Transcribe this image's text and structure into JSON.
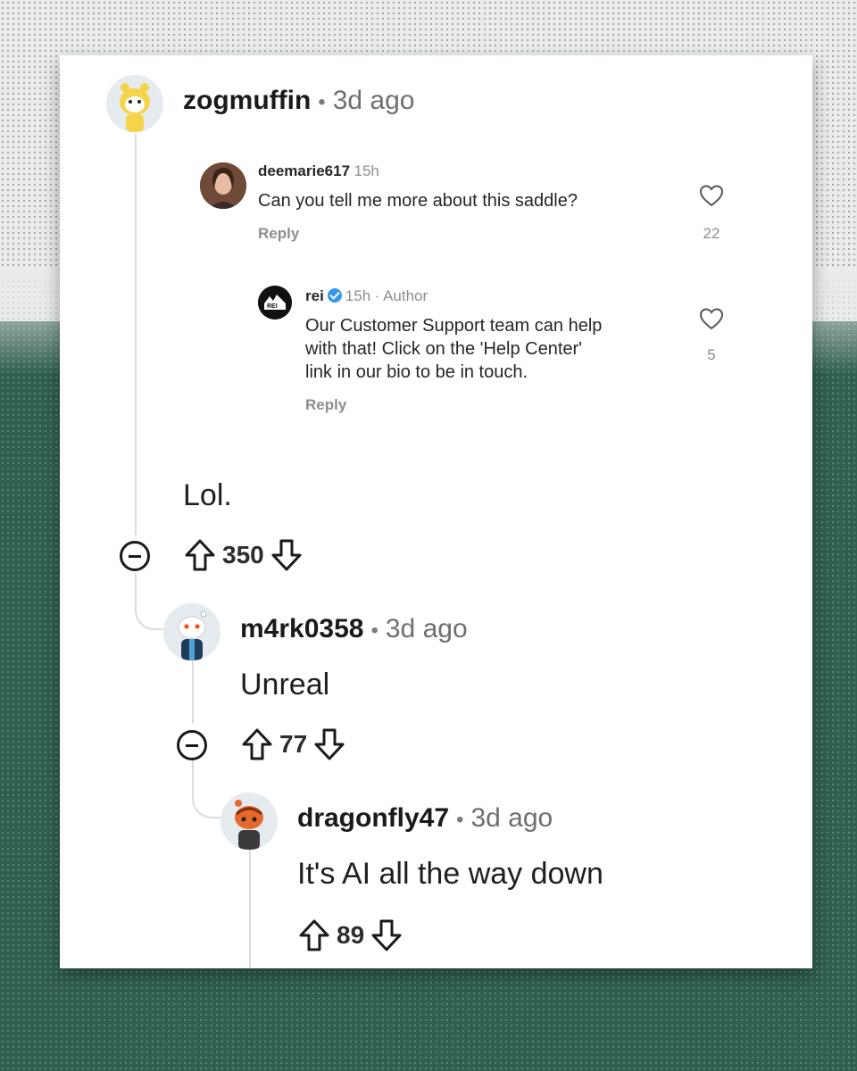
{
  "comments": [
    {
      "id": "c1",
      "username": "zogmuffin",
      "separator": "•",
      "time": "3d ago",
      "body": "Lol.",
      "votes": "350",
      "avatar_icon": "snoo-avatar-yellow"
    },
    {
      "id": "c2",
      "username": "m4rk0358",
      "separator": "•",
      "time": "3d ago",
      "body": "Unreal",
      "votes": "77",
      "avatar_icon": "snoo-avatar-white"
    },
    {
      "id": "c3",
      "username": "dragonfly47",
      "separator": "•",
      "time": "3d ago",
      "body": "It's AI all the way down",
      "votes": "89",
      "avatar_icon": "snoo-avatar-orange"
    }
  ],
  "embedded_instagram": {
    "comment": {
      "username": "deemarie617",
      "time": "15h",
      "text": "Can you tell me more about this saddle?",
      "reply_label": "Reply",
      "likes": "22"
    },
    "reply": {
      "username": "rei",
      "time": "15h",
      "author_label": "· Author",
      "text_lines": [
        "Our Customer Support team can help",
        "with that! Click on the 'Help Center'",
        "link in our bio to be in touch."
      ],
      "reply_label": "Reply",
      "likes": "5",
      "logo_text": "REI"
    }
  },
  "colors": {
    "background_green": "#2f5f4e",
    "card": "#ffffff",
    "thread_line": "#d9dcde",
    "verified": "#3897f0"
  }
}
